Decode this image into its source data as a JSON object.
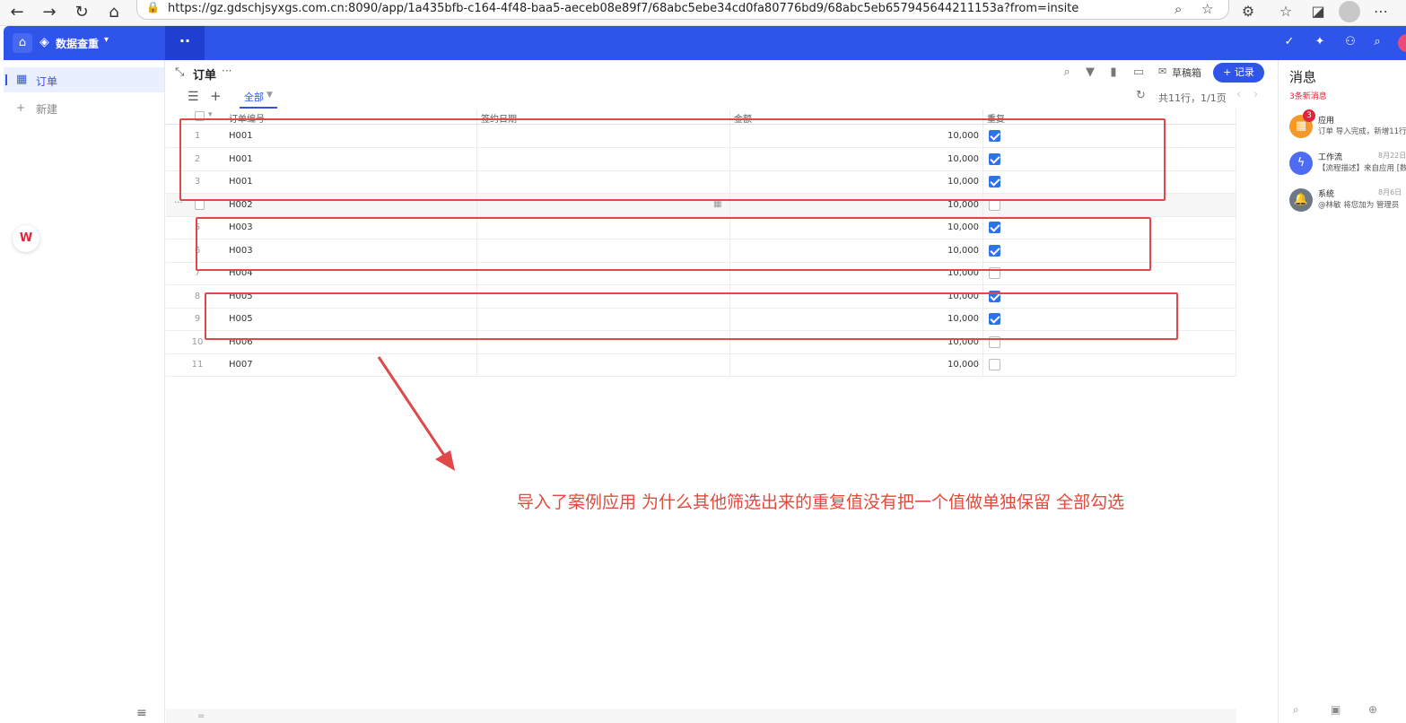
{
  "browser": {
    "url": "https://gz.gdschjsyxgs.com.cn:8090/app/1a435bfb-c164-4f48-baa5-aeceb08e89f7/68abc5ebe34cd0fa80776bd9/68abc5eb657945644211153a?from=insite"
  },
  "app": {
    "name": "数据查重",
    "accent": "#2e54e9"
  },
  "sidebar": {
    "items": [
      {
        "label": "订单",
        "icon": "table-icon",
        "active": true
      }
    ],
    "new_label": "新建"
  },
  "view": {
    "title": "订单",
    "toolbar": {
      "draft_label": "草稿箱",
      "add_record_label": "+ 记录"
    },
    "tab_label": "全部",
    "page_info": "共11行，1/1页"
  },
  "table": {
    "columns": [
      "订单编号",
      "签约日期",
      "金额",
      "重复"
    ],
    "rows": [
      {
        "n": "1",
        "order": "H001",
        "date": "",
        "amount": "10,000",
        "dup": true
      },
      {
        "n": "2",
        "order": "H001",
        "date": "",
        "amount": "10,000",
        "dup": true
      },
      {
        "n": "3",
        "order": "H001",
        "date": "",
        "amount": "10,000",
        "dup": true
      },
      {
        "n": "4",
        "order": "H002",
        "date": "",
        "amount": "10,000",
        "dup": false
      },
      {
        "n": "5",
        "order": "H003",
        "date": "",
        "amount": "10,000",
        "dup": true
      },
      {
        "n": "6",
        "order": "H003",
        "date": "",
        "amount": "10,000",
        "dup": true
      },
      {
        "n": "7",
        "order": "H004",
        "date": "",
        "amount": "10,000",
        "dup": false
      },
      {
        "n": "8",
        "order": "H005",
        "date": "",
        "amount": "10,000",
        "dup": true
      },
      {
        "n": "9",
        "order": "H005",
        "date": "",
        "amount": "10,000",
        "dup": true
      },
      {
        "n": "10",
        "order": "H006",
        "date": "",
        "amount": "10,000",
        "dup": false
      },
      {
        "n": "11",
        "order": "H007",
        "date": "",
        "amount": "10,000",
        "dup": false
      }
    ]
  },
  "annotation": {
    "text": "导入了案例应用  为什么其他筛选出来的重复值没有把一个值做单独保留 全部勾选",
    "color": "#e0484a"
  },
  "messages": {
    "title": "消息",
    "new_count_label": "3条新消息",
    "items": [
      {
        "name": "应用",
        "date": "",
        "preview": "订单 导入完成，新增11行",
        "badge": "3",
        "color": "#f19a2a",
        "icon": "app-grid-icon"
      },
      {
        "name": "工作流",
        "date": "8月22日",
        "preview": "【流程描述】来自应用 [数",
        "badge": "",
        "color": "#4e6cf2",
        "icon": "workflow-bolt-icon"
      },
      {
        "name": "系统",
        "date": "8月6日",
        "preview": "@林敏 将您加为 管理员",
        "badge": "",
        "color": "#6c7886",
        "icon": "bell-icon"
      }
    ]
  }
}
